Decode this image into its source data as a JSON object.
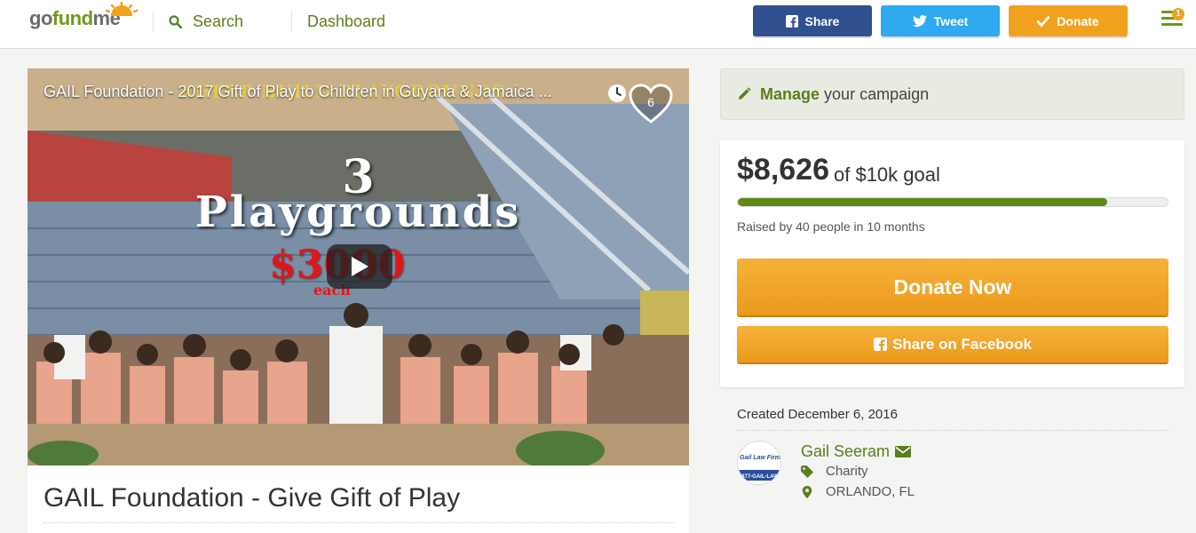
{
  "header": {
    "logo": {
      "go": "go",
      "fund": "fund",
      "me": "me"
    },
    "search_label": "Search",
    "dashboard_label": "Dashboard",
    "share_label": "Share",
    "tweet_label": "Tweet",
    "donate_label": "Donate",
    "notification_count": "1"
  },
  "video": {
    "title": "GAIL Foundation - 2017 Gift of Play to Children in Guyana & Jamaica ...",
    "likes": "6",
    "overlay_top": "#HELP BUILD PLAYGROUNDS",
    "overlay_number": "3",
    "overlay_word": "Playgrounds",
    "overlay_price": "$3000",
    "overlay_each": "each"
  },
  "campaign": {
    "title": "GAIL Foundation - Give Gift of Play"
  },
  "manage": {
    "strong": "Manage",
    "rest": "your campaign"
  },
  "stats": {
    "amount": "$8,626",
    "goal": "of $10k goal",
    "progress_fraction": 0.86,
    "raised_text": "Raised by 40 people in 10 months",
    "donate_now_label": "Donate Now",
    "share_facebook_label": "Share on Facebook"
  },
  "organizer": {
    "created": "Created December 6, 2016",
    "name": "Gail Seeram",
    "category": "Charity",
    "location": "ORLANDO, FL",
    "logo_text": "Gail Law Firm",
    "logo_phone": "877-GAIL-LAW"
  },
  "colors": {
    "brand_green": "#5b7f1c",
    "facebook": "#2f4f8f",
    "twitter": "#2eaaf0",
    "donate_orange": "#f0a21e"
  }
}
